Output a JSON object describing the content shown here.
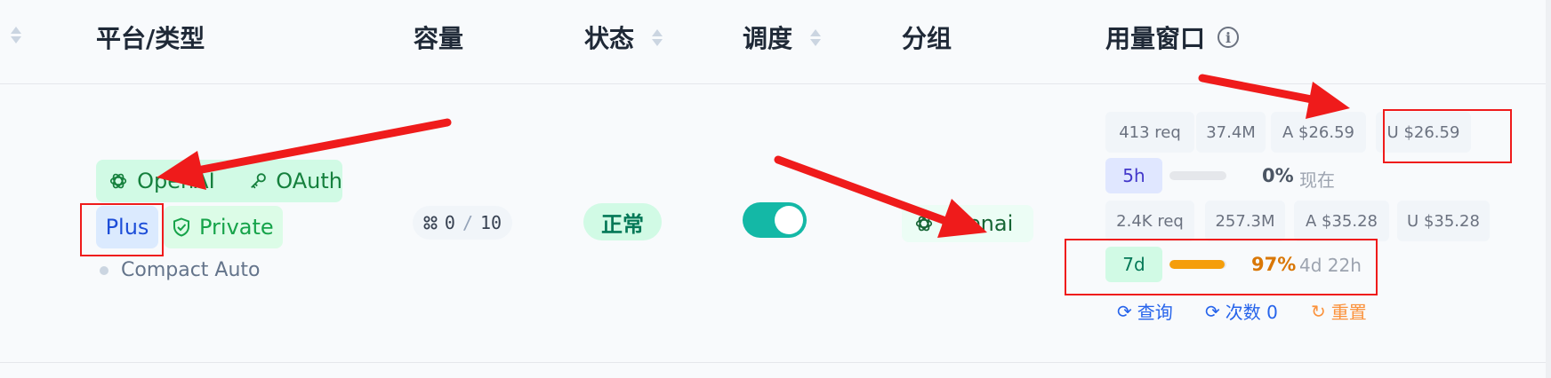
{
  "columns": {
    "platform_type": "平台/类型",
    "capacity": "容量",
    "status": "状态",
    "schedule": "调度",
    "group": "分组",
    "usage_window": "用量窗口"
  },
  "row": {
    "platform_tag": "OpenAI",
    "auth_tag": "OAuth",
    "plan_tag": "Plus",
    "privacy_tag": "Private",
    "compact_mode": "Compact Auto",
    "capacity_used": "0",
    "capacity_sep": "/",
    "capacity_total": "10",
    "status": "正常",
    "schedule_enabled": true,
    "group": "openai",
    "usage": {
      "window_5h": {
        "req": "413 req",
        "tokens": "37.4M",
        "a_cost": "A $26.59",
        "u_cost": "U $26.59",
        "period": "5h",
        "percent_label": "0%",
        "percent_value": 0,
        "reset": "现在"
      },
      "window_7d": {
        "req": "2.4K req",
        "tokens": "257.3M",
        "a_cost": "A $35.28",
        "u_cost": "U $35.28",
        "period": "7d",
        "percent_label": "97%",
        "percent_value": 97,
        "reset": "4d 22h"
      }
    },
    "actions": {
      "query": "查询",
      "count": "次数 0",
      "reset": "重置"
    }
  },
  "colors": {
    "annotation_red": "#ef1b1b",
    "toggle_on": "#14b8a6",
    "bar_7d": "#f59e0b",
    "pct_7d": "#d97706"
  },
  "icons": {
    "openai": "openai-icon",
    "key": "key-icon",
    "shield": "shield-check-icon",
    "capacity": "grid-icon",
    "info": "info-icon",
    "refresh": "refresh-icon"
  }
}
